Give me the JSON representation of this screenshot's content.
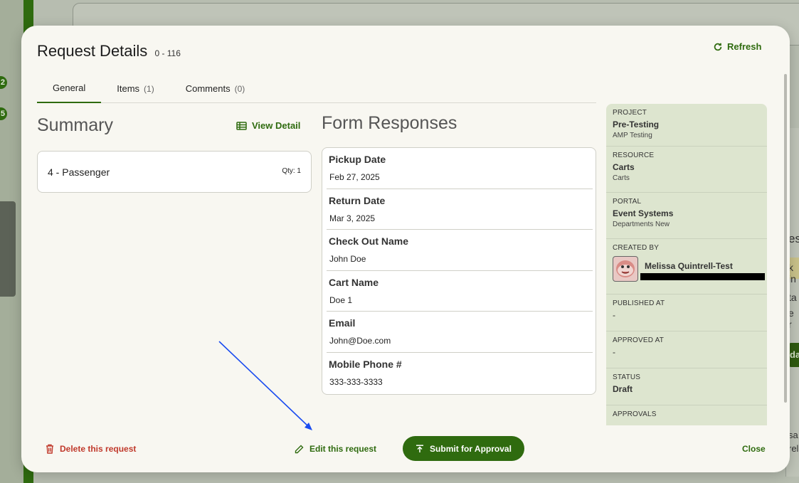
{
  "background": {
    "badges": [
      "2",
      "5"
    ],
    "right_fragments": [
      "es",
      "k in",
      "ta",
      "e r",
      "da",
      "sa",
      "rel"
    ]
  },
  "modal": {
    "title": "Request Details",
    "request_id": "0 - 116",
    "refresh_label": "Refresh",
    "tabs": [
      {
        "label": "General",
        "count": "",
        "active": true
      },
      {
        "label": "Items",
        "count": "(1)",
        "active": false
      },
      {
        "label": "Comments",
        "count": "(0)",
        "active": false
      }
    ]
  },
  "summary": {
    "heading": "Summary",
    "view_detail_label": "View Detail",
    "items": [
      {
        "name": "4 - Passenger",
        "qty": "Qty: 1"
      }
    ]
  },
  "form_responses": {
    "heading": "Form Responses",
    "fields": [
      {
        "label": "Pickup Date",
        "value": "Feb 27, 2025"
      },
      {
        "label": "Return Date",
        "value": "Mar 3, 2025"
      },
      {
        "label": "Check Out Name",
        "value": "John Doe"
      },
      {
        "label": "Cart Name",
        "value": "Doe 1"
      },
      {
        "label": "Email",
        "value": "John@Doe.com"
      },
      {
        "label": "Mobile Phone #",
        "value": "333-333-3333"
      }
    ]
  },
  "details": {
    "project": {
      "label": "PROJECT",
      "value": "Pre-Testing",
      "sub": "AMP Testing"
    },
    "resource": {
      "label": "RESOURCE",
      "value": "Carts",
      "sub": "Carts"
    },
    "portal": {
      "label": "PORTAL",
      "value": "Event Systems",
      "sub": "Departments New"
    },
    "created_by": {
      "label": "CREATED BY",
      "name": "Melissa Quintrell-Test"
    },
    "published_at": {
      "label": "PUBLISHED AT",
      "value": "-"
    },
    "approved_at": {
      "label": "APPROVED AT",
      "value": "-"
    },
    "status": {
      "label": "STATUS",
      "value": "Draft"
    },
    "approvals": {
      "label": "APPROVALS"
    }
  },
  "footer": {
    "delete_label": "Delete this request",
    "edit_label": "Edit this request",
    "submit_label": "Submit for Approval",
    "close_label": "Close"
  },
  "colors": {
    "primary_green": "#2f6b0f",
    "danger_red": "#c0392b",
    "panel_bg": "#dde5cf",
    "annotation_arrow": "#1a4cf0"
  }
}
